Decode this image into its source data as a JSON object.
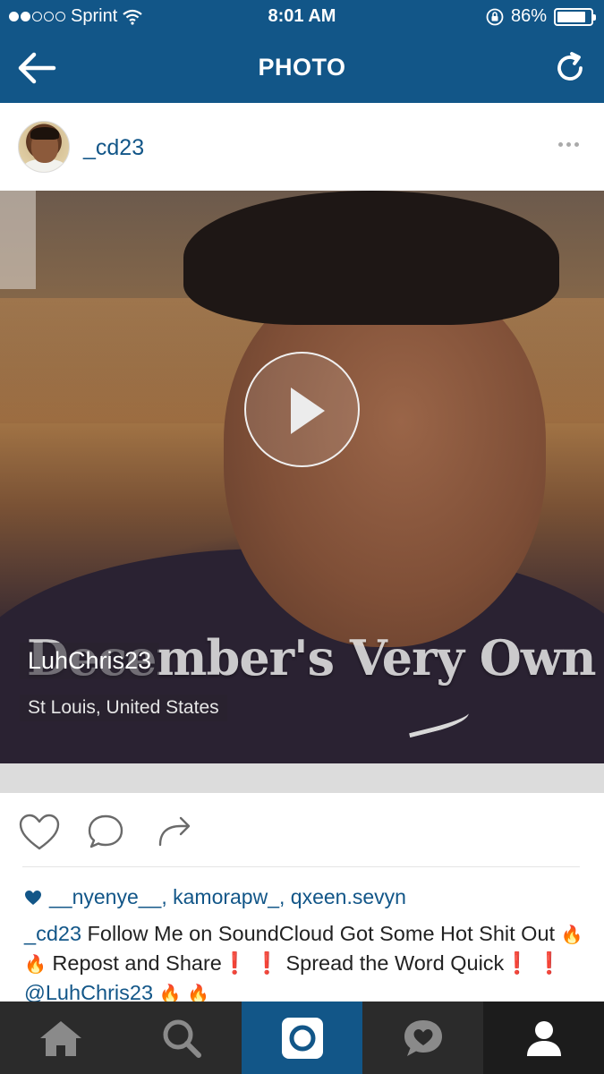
{
  "status_bar": {
    "carrier": "Sprint",
    "signal_bars_filled": 2,
    "signal_bars_total": 5,
    "time": "8:01 AM",
    "battery_percent": "86%",
    "battery_level": 0.86
  },
  "nav": {
    "title": "PHOTO",
    "back_icon": "back-arrow-icon",
    "refresh_icon": "refresh-icon"
  },
  "post": {
    "username": "_cd23",
    "media": {
      "watermark_text": "December's Very Own",
      "overlay_name": "LuhChris23",
      "overlay_location": "St Louis, United States",
      "play_icon": "play-icon"
    },
    "likes": {
      "users": [
        "__nyenye__",
        "kamorapw_",
        "qxeen.sevyn"
      ],
      "text": "__nyenye__, kamorapw_, qxeen.sevyn"
    },
    "caption": {
      "author": "_cd23",
      "part1": " Follow Me on SoundCloud Got Some Hot Shit Out ",
      "fire": "🔥",
      "part2": " Repost and Share",
      "bang": "❗",
      "part3": " Spread the Word Quick",
      "mention": "@LuhChris23"
    }
  },
  "tabs": [
    {
      "name": "home",
      "icon": "home-icon"
    },
    {
      "name": "search",
      "icon": "search-icon"
    },
    {
      "name": "camera",
      "icon": "camera-icon",
      "active": true
    },
    {
      "name": "activity",
      "icon": "heart-bubble-icon"
    },
    {
      "name": "profile",
      "icon": "profile-icon"
    }
  ],
  "colors": {
    "brand_blue": "#125688",
    "tab_bar": "#2b2b2b",
    "link": "#125688"
  }
}
